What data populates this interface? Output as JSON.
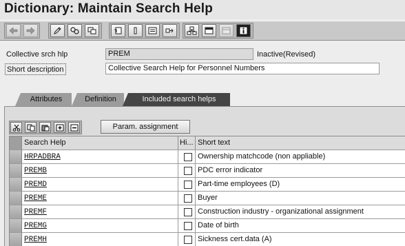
{
  "window": {
    "title": "Dictionary: Maintain Search Help"
  },
  "toolbar": {
    "buttons": [
      {
        "name": "back-icon",
        "glyph": "⇦"
      },
      {
        "name": "forward-icon",
        "glyph": "⇨"
      },
      {
        "name": "display-change-icon",
        "glyph": "✎"
      },
      {
        "name": "active-inactive-icon",
        "glyph": "⇄"
      },
      {
        "name": "other-object-icon",
        "glyph": "⧉"
      },
      {
        "name": "check-icon",
        "glyph": "⎘"
      },
      {
        "name": "activate-icon",
        "glyph": "i"
      },
      {
        "name": "test-icon",
        "glyph": "▤"
      },
      {
        "name": "where-used-icon",
        "glyph": "⎆"
      },
      {
        "name": "hierarchy-icon",
        "glyph": "品"
      },
      {
        "name": "display-object-list-icon",
        "glyph": "▭"
      },
      {
        "name": "navigation-window-icon",
        "glyph": "▭"
      },
      {
        "name": "info-icon",
        "glyph": "i"
      }
    ]
  },
  "header": {
    "collective_label": "Collective srch hlp",
    "collective_value": "PREM",
    "status": "Inactive(Revised)",
    "short_desc_label": "Short description",
    "short_desc_value": "Collective Search Help for Personnel Numbers"
  },
  "tabs": [
    {
      "label": "Attributes",
      "active": false
    },
    {
      "label": "Definition",
      "active": false
    },
    {
      "label": "Included search helps",
      "active": true
    }
  ],
  "table_toolbar": {
    "icons": [
      "cut-icon",
      "copy-icon",
      "paste-icon",
      "insert-row-icon",
      "delete-row-icon"
    ],
    "param_button": "Param. assignment"
  },
  "table": {
    "columns": [
      "Search Help",
      "Hi...",
      "Short text"
    ],
    "rows": [
      {
        "search_help": "HRPADBRA",
        "hidden": false,
        "short_text": "Ownership matchcode (non appliable)"
      },
      {
        "search_help": "PREMB",
        "hidden": false,
        "short_text": "PDC error indicator"
      },
      {
        "search_help": "PREMD",
        "hidden": false,
        "short_text": "Part-time employees (D)"
      },
      {
        "search_help": "PREME",
        "hidden": false,
        "short_text": "Buyer"
      },
      {
        "search_help": "PREMF",
        "hidden": false,
        "short_text": "Construction industry - organizational assignment"
      },
      {
        "search_help": "PREMG",
        "hidden": false,
        "short_text": "Date of birth"
      },
      {
        "search_help": "PREMH",
        "hidden": false,
        "short_text": "Sickness cert.data (A)"
      }
    ]
  }
}
